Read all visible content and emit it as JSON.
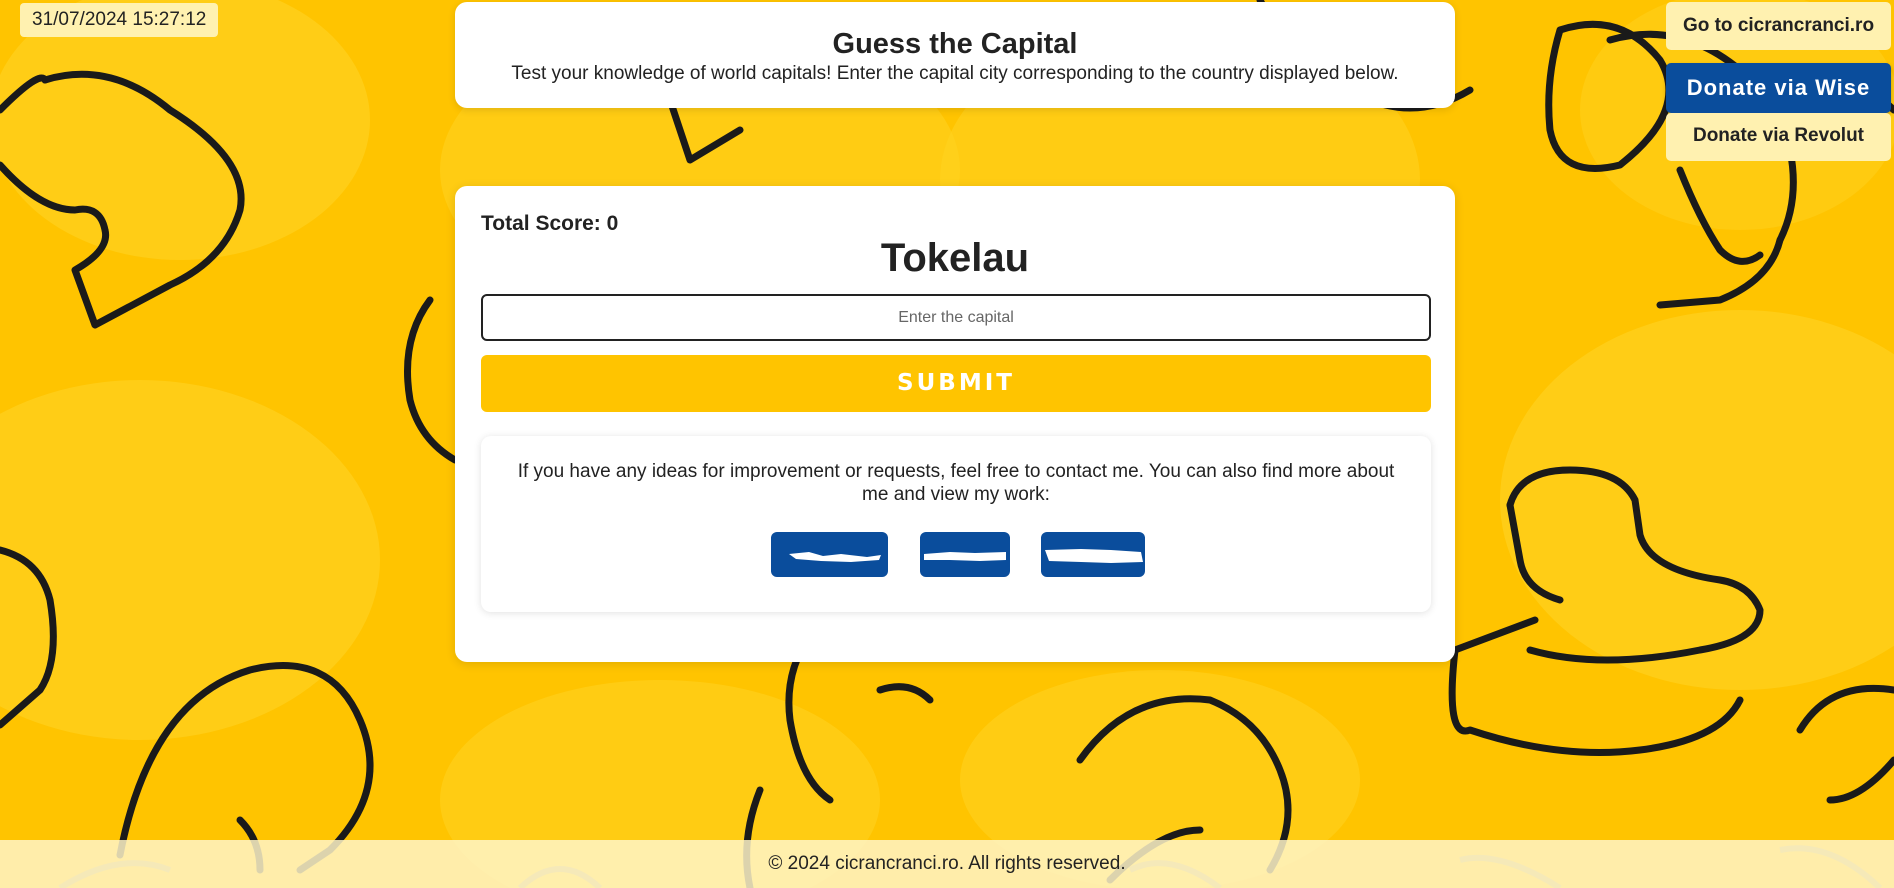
{
  "datetime": "31/07/2024 15:27:12",
  "header": {
    "title": "Guess the Capital",
    "subtitle": "Test your knowledge of world capitals! Enter the capital city corresponding to the country displayed below."
  },
  "top_right": {
    "go_label": "Go to cicrancranci.ro",
    "wise_label": "Donate via Wise",
    "revolut_label": "Donate via Revolut"
  },
  "game": {
    "score_label": "Total Score: 0",
    "country": "Tokelau",
    "input_placeholder": "Enter the capital",
    "submit_label": "SUBMIT"
  },
  "contact": {
    "text": "If you have any ideas for improvement or requests, feel free to contact me. You can also find more about me and view my work:",
    "links": [
      "linkedin-icon",
      "facebook-icon",
      "instagram-icon"
    ]
  },
  "footer": {
    "text": "© 2024 cicrancranci.ro. All rights reserved."
  },
  "colors": {
    "background": "#ffc400",
    "accent_yellow": "#ffc400",
    "brand_blue": "#0a4d9c",
    "pale_yellow": "#fff1b0"
  }
}
